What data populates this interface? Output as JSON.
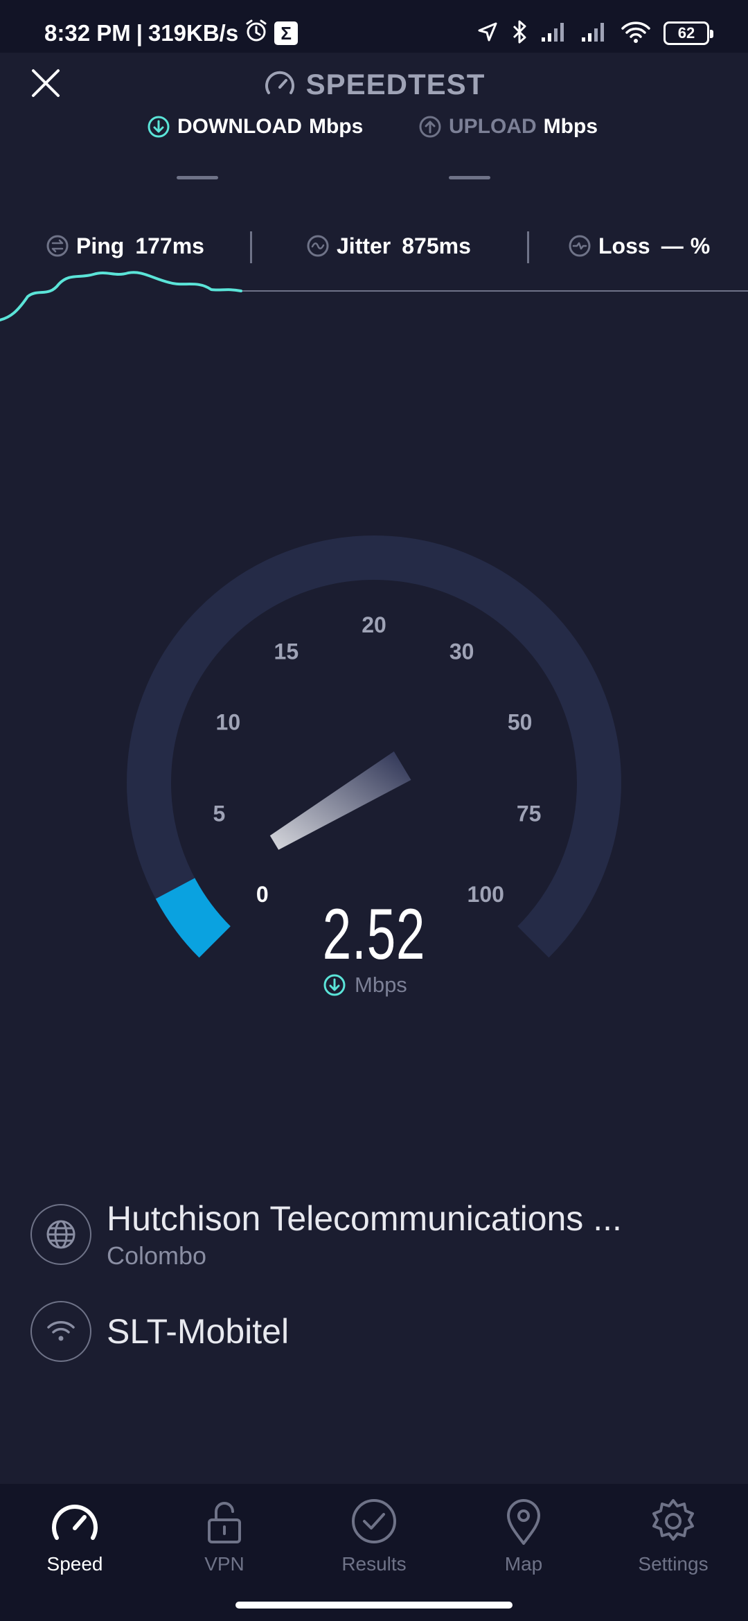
{
  "status_bar": {
    "time": "8:32 PM",
    "separator": "|",
    "network_speed": "319KB/s",
    "battery": "62",
    "icons": [
      "alarm-icon",
      "sigma-icon",
      "location-icon",
      "bluetooth-icon",
      "signal-icon",
      "signal-icon",
      "wifi-icon",
      "battery-icon"
    ]
  },
  "header": {
    "title": "SPEEDTEST",
    "tabs": [
      {
        "label": "DOWNLOAD",
        "unit": "Mbps",
        "value": "—",
        "active": true
      },
      {
        "label": "UPLOAD",
        "unit": "Mbps",
        "value": "—",
        "active": false
      }
    ]
  },
  "metrics": {
    "ping": {
      "label": "Ping",
      "value": "177ms"
    },
    "jitter": {
      "label": "Jitter",
      "value": "875ms"
    },
    "loss": {
      "label": "Loss",
      "value": "—",
      "unit": "%"
    }
  },
  "gauge": {
    "ticks": [
      "0",
      "5",
      "10",
      "15",
      "20",
      "30",
      "50",
      "75",
      "100"
    ],
    "current_value": "2.52",
    "unit": "Mbps",
    "progress_value": 2.52
  },
  "provider": {
    "name": "Hutchison Telecommunications ...",
    "location": "Colombo",
    "network": "SLT-Mobitel"
  },
  "nav": {
    "items": [
      {
        "label": "Speed",
        "icon": "speedometer-icon",
        "active": true
      },
      {
        "label": "VPN",
        "icon": "unlock-icon",
        "active": false
      },
      {
        "label": "Results",
        "icon": "check-circle-icon",
        "active": false
      },
      {
        "label": "Map",
        "icon": "map-pin-icon",
        "active": false
      },
      {
        "label": "Settings",
        "icon": "gear-icon",
        "active": false
      }
    ]
  },
  "colors": {
    "background": "#1b1d30",
    "bar_background": "#121426",
    "accent_cyan": "#5be4d8",
    "gauge_fill": "#0aa2e0",
    "gauge_track": "#252b47",
    "muted_text": "#7c8096"
  }
}
